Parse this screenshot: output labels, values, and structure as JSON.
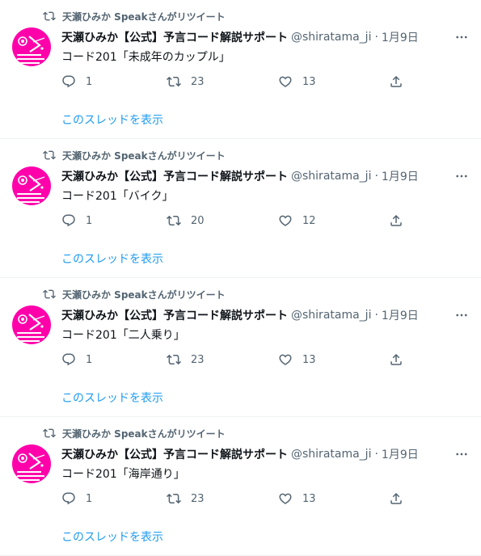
{
  "colors": {
    "accent": "#1d9bf0",
    "muted": "#536471",
    "text": "#0f1419",
    "avatar_bg": "#ff00aa"
  },
  "tweets": [
    {
      "retweeter": "天瀬ひみか Speakさんがリツイート",
      "author_name": "天瀬ひみか【公式】予言コード解説サポート",
      "handle": "@shiratama_ji",
      "separator": "·",
      "date": "1月9日",
      "text": "コード201「未成年のカップル」",
      "replies": "1",
      "retweets": "23",
      "likes": "13",
      "show_thread": "このスレッドを表示"
    },
    {
      "retweeter": "天瀬ひみか Speakさんがリツイート",
      "author_name": "天瀬ひみか【公式】予言コード解説サポート",
      "handle": "@shiratama_ji",
      "separator": "·",
      "date": "1月9日",
      "text": "コード201「バイク」",
      "replies": "1",
      "retweets": "20",
      "likes": "12",
      "show_thread": "このスレッドを表示"
    },
    {
      "retweeter": "天瀬ひみか Speakさんがリツイート",
      "author_name": "天瀬ひみか【公式】予言コード解説サポート",
      "handle": "@shiratama_ji",
      "separator": "·",
      "date": "1月9日",
      "text": "コード201「二人乗り」",
      "replies": "1",
      "retweets": "23",
      "likes": "13",
      "show_thread": "このスレッドを表示"
    },
    {
      "retweeter": "天瀬ひみか Speakさんがリツイート",
      "author_name": "天瀬ひみか【公式】予言コード解説サポート",
      "handle": "@shiratama_ji",
      "separator": "·",
      "date": "1月9日",
      "text": "コード201「海岸通り」",
      "replies": "1",
      "retweets": "23",
      "likes": "13",
      "show_thread": "このスレッドを表示"
    }
  ],
  "icons": {
    "retweet_indicator": "retweet-icon",
    "more": "more-icon",
    "reply": "reply-icon",
    "retweet": "retweet-icon",
    "like": "heart-icon",
    "share": "share-icon"
  }
}
